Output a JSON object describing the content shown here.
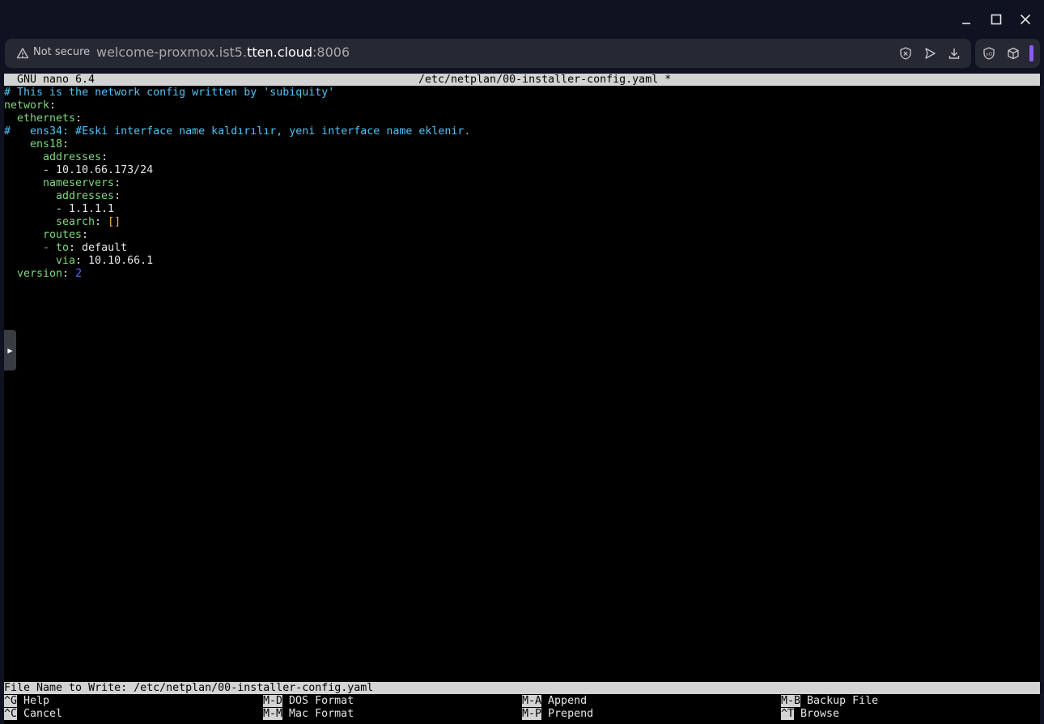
{
  "browser": {
    "security_label": "Not secure",
    "url_prefix": "welcome-proxmox.ist5.",
    "url_domain": "tten.cloud",
    "url_port": ":8006"
  },
  "nano": {
    "version": "GNU nano 6.4",
    "file_title": "/etc/netplan/00-installer-config.yaml *",
    "lines": {
      "l1": "# This is the network config written by 'subiquity'",
      "l2_key": "network",
      "l3_key": "ethernets",
      "l4": "#   ens34: #Eski interface name kaldırılır, yeni interface name eklenir.",
      "l5_key": "ens18",
      "l6_key": "addresses",
      "l7_val": "10.10.66.173/24",
      "l8_key": "nameservers",
      "l9_key": "addresses",
      "l10_val": "1.1.1.1",
      "l11_key": "search",
      "l11_val": "[]",
      "l12_key": "routes",
      "l13_key": "to",
      "l13_val": "default",
      "l14_key": "via",
      "l14_val": "10.10.66.1",
      "l15_key": "version",
      "l15_val": "2"
    },
    "prompt": "File Name to Write: /etc/netplan/00-installer-config.yaml",
    "shortcuts": [
      {
        "key": "^G",
        "label": "Help"
      },
      {
        "key": "M-D",
        "label": "DOS Format"
      },
      {
        "key": "M-A",
        "label": "Append"
      },
      {
        "key": "M-B",
        "label": "Backup File"
      },
      {
        "key": "^C",
        "label": "Cancel"
      },
      {
        "key": "M-M",
        "label": "Mac Format"
      },
      {
        "key": "M-P",
        "label": "Prepend"
      },
      {
        "key": "^T",
        "label": "Browse"
      }
    ]
  },
  "colors": {
    "comment": "#4fc3f7",
    "key": "#7dd87d",
    "number": "#5b6cff",
    "bracket": "#f0c040",
    "accent": "#8b5cf6"
  }
}
